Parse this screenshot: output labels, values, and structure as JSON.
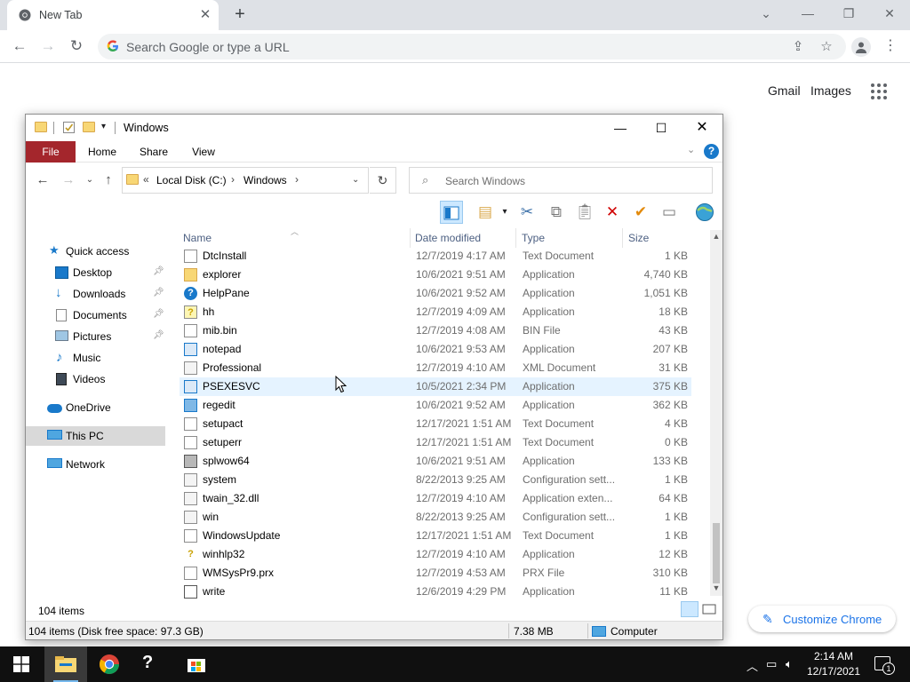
{
  "chrome": {
    "tab_title": "New Tab",
    "tab_close": "✕",
    "new_tab": "+",
    "omnibox_placeholder": "Search Google or type a URL",
    "links": {
      "gmail": "Gmail",
      "images": "Images"
    },
    "customize_label": "Customize Chrome"
  },
  "explorer": {
    "title": "Windows",
    "ribbon_tabs": [
      "File",
      "Home",
      "Share",
      "View"
    ],
    "address": {
      "prefix": "«",
      "crumbs": [
        "Local Disk (C:)",
        "Windows"
      ]
    },
    "search_placeholder": "Search Windows",
    "nav": [
      {
        "label": "Quick access",
        "icon": "star-icon",
        "pinned": false
      },
      {
        "label": "Desktop",
        "icon": "desktop-icon",
        "pinned": true
      },
      {
        "label": "Downloads",
        "icon": "download-icon",
        "pinned": true
      },
      {
        "label": "Documents",
        "icon": "documents-icon",
        "pinned": true
      },
      {
        "label": "Pictures",
        "icon": "pictures-icon",
        "pinned": true
      },
      {
        "label": "Music",
        "icon": "music-icon",
        "pinned": false
      },
      {
        "label": "Videos",
        "icon": "videos-icon",
        "pinned": false
      },
      {
        "label": "OneDrive",
        "icon": "cloud-icon",
        "pinned": false
      },
      {
        "label": "This PC",
        "icon": "computer-icon",
        "pinned": false,
        "selected": true
      },
      {
        "label": "Network",
        "icon": "network-icon",
        "pinned": false
      }
    ],
    "columns": {
      "name": "Name",
      "date": "Date modified",
      "type": "Type",
      "size": "Size"
    },
    "files": [
      {
        "name": "DtcInstall",
        "date": "12/7/2019 4:17 AM",
        "type": "Text Document",
        "size": "1 KB",
        "icon": "text-file-icon"
      },
      {
        "name": "explorer",
        "date": "10/6/2021 9:51 AM",
        "type": "Application",
        "size": "4,740 KB",
        "icon": "folder-app-icon"
      },
      {
        "name": "HelpPane",
        "date": "10/6/2021 9:52 AM",
        "type": "Application",
        "size": "1,051 KB",
        "icon": "help-icon"
      },
      {
        "name": "hh",
        "date": "12/7/2019 4:09 AM",
        "type": "Application",
        "size": "18 KB",
        "icon": "help-file-icon"
      },
      {
        "name": "mib.bin",
        "date": "12/7/2019 4:08 AM",
        "type": "BIN File",
        "size": "43 KB",
        "icon": "blank-file-icon"
      },
      {
        "name": "notepad",
        "date": "10/6/2021 9:53 AM",
        "type": "Application",
        "size": "207 KB",
        "icon": "app-window-icon"
      },
      {
        "name": "Professional",
        "date": "12/7/2019 4:10 AM",
        "type": "XML Document",
        "size": "31 KB",
        "icon": "xml-file-icon"
      },
      {
        "name": "PSEXESVC",
        "date": "10/5/2021 2:34 PM",
        "type": "Application",
        "size": "375 KB",
        "icon": "app-window-icon",
        "hover": true
      },
      {
        "name": "regedit",
        "date": "10/6/2021 9:52 AM",
        "type": "Application",
        "size": "362 KB",
        "icon": "registry-icon"
      },
      {
        "name": "setupact",
        "date": "12/17/2021 1:51 AM",
        "type": "Text Document",
        "size": "4 KB",
        "icon": "text-file-icon"
      },
      {
        "name": "setuperr",
        "date": "12/17/2021 1:51 AM",
        "type": "Text Document",
        "size": "0 KB",
        "icon": "text-file-icon"
      },
      {
        "name": "splwow64",
        "date": "10/6/2021 9:51 AM",
        "type": "Application",
        "size": "133 KB",
        "icon": "printer-icon"
      },
      {
        "name": "system",
        "date": "8/22/2013 9:25 AM",
        "type": "Configuration sett...",
        "size": "1 KB",
        "icon": "config-file-icon"
      },
      {
        "name": "twain_32.dll",
        "date": "12/7/2019 4:10 AM",
        "type": "Application exten...",
        "size": "64 KB",
        "icon": "dll-file-icon"
      },
      {
        "name": "win",
        "date": "8/22/2013 9:25 AM",
        "type": "Configuration sett...",
        "size": "1 KB",
        "icon": "config-file-icon"
      },
      {
        "name": "WindowsUpdate",
        "date": "12/17/2021 1:51 AM",
        "type": "Text Document",
        "size": "1 KB",
        "icon": "text-file-icon"
      },
      {
        "name": "winhlp32",
        "date": "12/7/2019 4:10 AM",
        "type": "Application",
        "size": "12 KB",
        "icon": "help-question-icon"
      },
      {
        "name": "WMSysPr9.prx",
        "date": "12/7/2019 4:53 AM",
        "type": "PRX File",
        "size": "310 KB",
        "icon": "blank-file-icon"
      },
      {
        "name": "write",
        "date": "12/6/2019 4:29 PM",
        "type": "Application",
        "size": "11 KB",
        "icon": "write-icon"
      }
    ],
    "item_count": "104 items",
    "detail_status": "104 items (Disk free space: 97.3 GB)",
    "detail_size": "7.38 MB",
    "detail_location": "Computer"
  },
  "taskbar": {
    "time": "2:14 AM",
    "date": "12/17/2021",
    "notification_count": "1"
  },
  "colors": {
    "file_tab": "#a4262c",
    "accent": "#1a73e8",
    "hover_row": "#e5f3ff",
    "taskbar": "#101010"
  }
}
